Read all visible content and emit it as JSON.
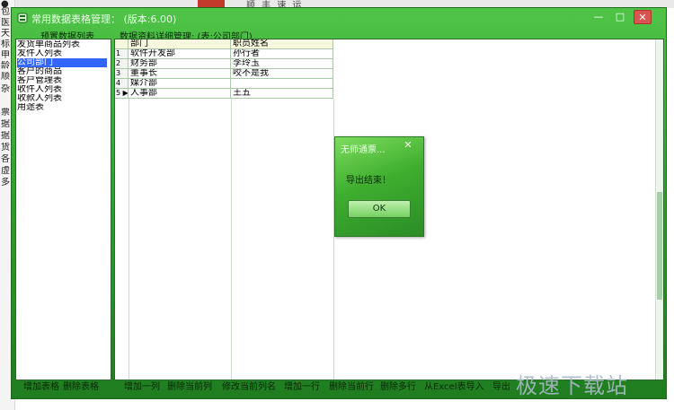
{
  "background": {
    "left_chars": [
      "●",
      "包",
      "医",
      "天",
      "标",
      "申",
      "龄",
      "顺",
      "杂",
      "票",
      "据",
      "据",
      "货",
      "各",
      "虚",
      "多"
    ],
    "top_text": "顺 丰 速 运"
  },
  "window": {
    "title": "常用数据表格管理： (版本:6.00)",
    "controls": {
      "min": "—",
      "max": "□",
      "close": "✕"
    }
  },
  "left_panel": {
    "label": "预置数据列表",
    "items": [
      "发货单商品列表",
      "发件人列表",
      "公司部门",
      "客户的商品",
      "客户管理表",
      "收件人列表",
      "收款人列表",
      "用途表"
    ],
    "selected_index": 2,
    "buttons": {
      "add": "增加表格",
      "delete": "删除表格"
    }
  },
  "right_panel": {
    "label": "数据资料详细管理: (表:公司部门)",
    "columns": [
      "部门",
      "职员姓名"
    ],
    "rows": [
      {
        "no": "1",
        "c1": "软件开发部",
        "c2": "孙行者"
      },
      {
        "no": "2",
        "c1": "财务部",
        "c2": "李玲玉"
      },
      {
        "no": "3",
        "c1": "董事长",
        "c2": "咬不是我"
      },
      {
        "no": "4",
        "c1": "媒介部",
        "c2": ""
      },
      {
        "no": "5 ▶",
        "c1": "人事部",
        "c2": "王五"
      }
    ]
  },
  "bottom_buttons": {
    "add_col": "增加一列",
    "del_col": "删除当前列",
    "rename_col": "修改当前列名",
    "add_row": "增加一行",
    "del_row": "删除当前行",
    "del_rows": "删除多行",
    "import_excel": "从Excel表导入",
    "export": "导出"
  },
  "dialog": {
    "title": "无师通票...",
    "message": "导出结束！",
    "ok": "OK",
    "close": "✕"
  },
  "watermark": "极速下载站",
  "colors": {
    "window_green": "#2f9e2c",
    "selection_blue": "#3366ff",
    "header_yellow": "#f6f7dc"
  }
}
